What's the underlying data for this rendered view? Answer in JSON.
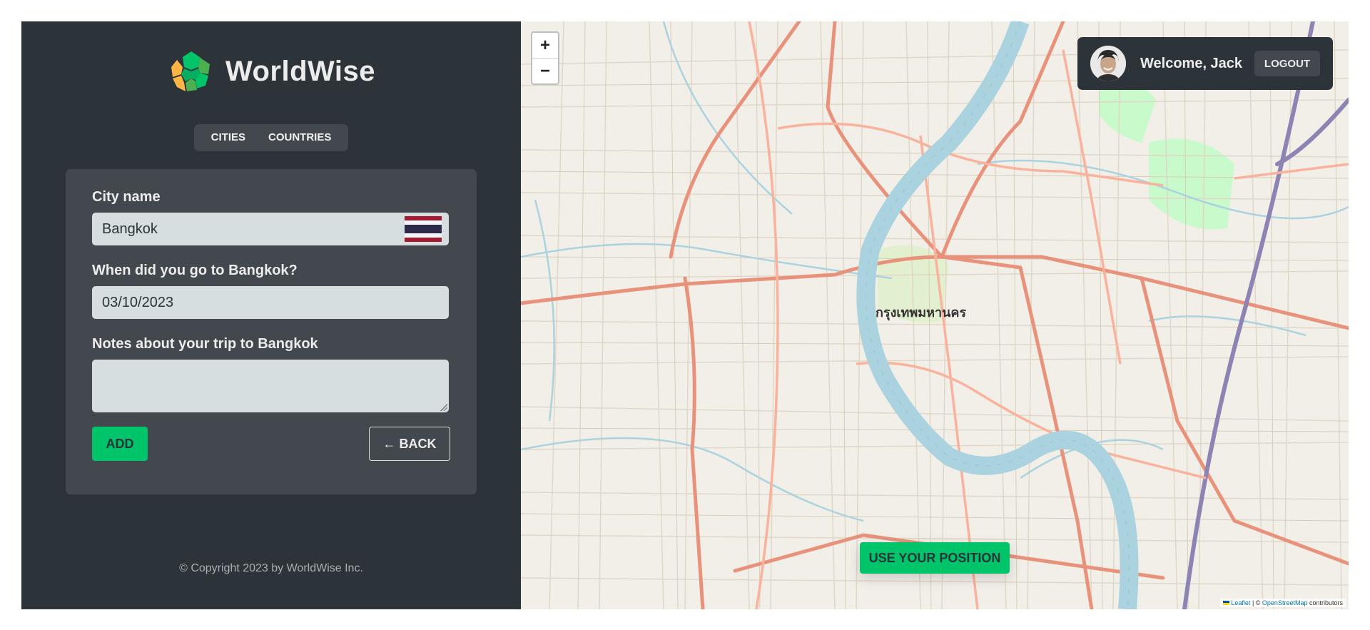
{
  "brand": {
    "name": "WorldWise"
  },
  "nav": {
    "cities": "CITIES",
    "countries": "COUNTRIES"
  },
  "form": {
    "city_label": "City name",
    "city_value": "Bangkok",
    "date_label": "When did you go to Bangkok?",
    "date_value": "03/10/2023",
    "notes_label": "Notes about your trip to Bangkok",
    "notes_value": "",
    "add_label": "ADD",
    "back_label": "← BACK"
  },
  "footer": {
    "copyright": "© Copyright 2023 by WorldWise Inc."
  },
  "map": {
    "zoom_in": "+",
    "zoom_out": "−",
    "city_label": "กรุงเทพมหานคร",
    "use_position": "USE YOUR POSITION",
    "attribution_leaflet": "Leaflet",
    "attribution_sep": " | © ",
    "attribution_osm": "OpenStreetMap",
    "attribution_suffix": " contributors"
  },
  "user": {
    "welcome": "Welcome, Jack",
    "logout": "LOGOUT"
  },
  "colors": {
    "sidebar_bg": "#2d3439",
    "panel_bg": "#42484d",
    "input_bg": "#d6dee0",
    "brand_green": "#00c46a",
    "river": "#aad3df"
  },
  "icons": [
    "worldwise-logo-icon",
    "thailand-flag-icon",
    "avatar-photo"
  ]
}
